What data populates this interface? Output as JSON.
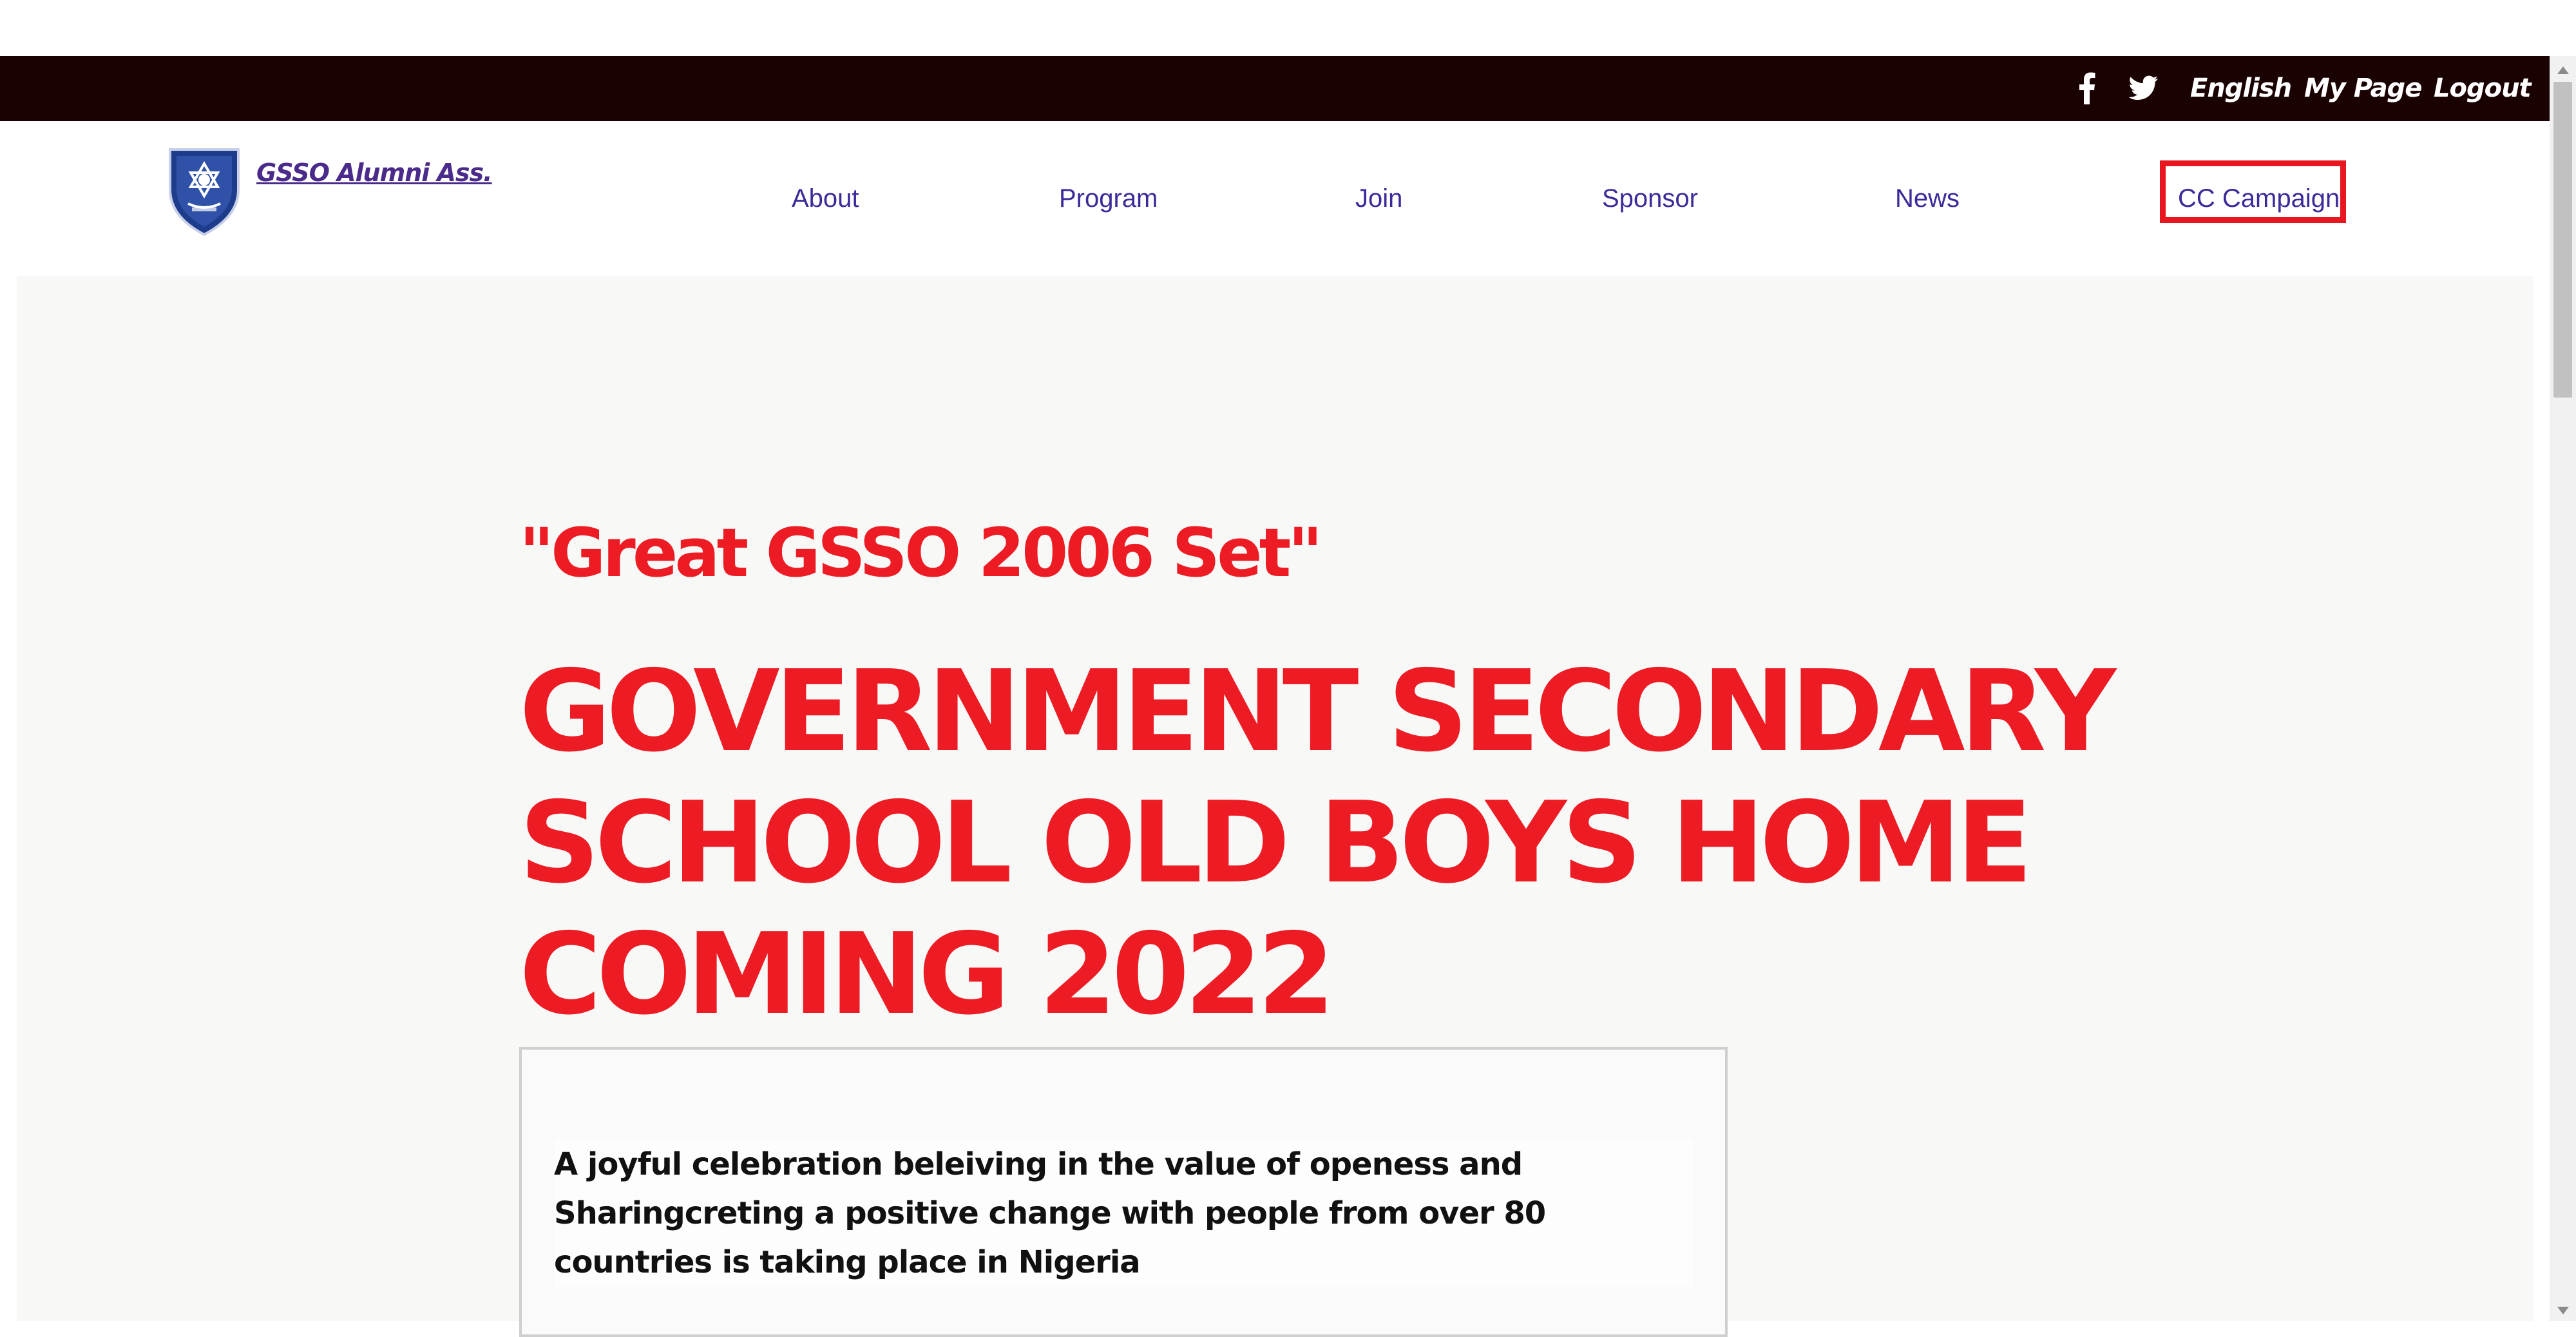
{
  "topbar": {
    "language": "English",
    "my_page": "My Page",
    "logout": "Logout",
    "icons": [
      "facebook-icon",
      "twitter-icon"
    ],
    "background_color": "#1a0203"
  },
  "header": {
    "logo_text": "GSSO Alumni Ass.",
    "nav": {
      "about": "About",
      "program": "Program",
      "join": "Join",
      "sponsor": "Sponsor",
      "news": "News",
      "cc_campaign": "CC Campaign"
    },
    "highlight_color": "#e8161e",
    "nav_color": "#3a2a9a"
  },
  "hero": {
    "subtitle": "\"Great GSSO 2006 Set\"",
    "title": "GOVERNMENT SECONDARY SCHOOL OLD BOYS HOME COMING 2022",
    "card_text": "A joyful celebration beleiving in the value of openess and Sharingcreting a positive change with people from over 80 countries is taking place in Nigeria",
    "accent_color": "#ed1c24"
  }
}
